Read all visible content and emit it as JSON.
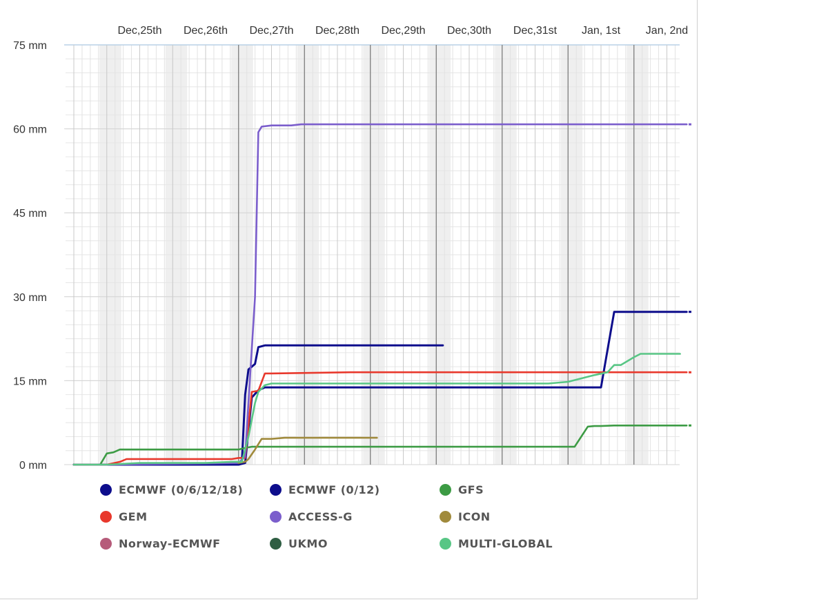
{
  "chart_data": {
    "type": "line",
    "x_tick_labels": [
      "Dec,25th",
      "Dec,26th",
      "Dec,27th",
      "Dec,28th",
      "Dec,29th",
      "Dec,30th",
      "Dec,31st",
      "Jan, 1st",
      "Jan, 2nd"
    ],
    "y_tick_labels": [
      "0 mm",
      "15 mm",
      "30 mm",
      "45 mm",
      "60 mm",
      "75 mm"
    ],
    "x_range": [
      0,
      9.3
    ],
    "ylim": [
      0,
      75
    ],
    "grid": true,
    "legend_position": "bottom",
    "series": [
      {
        "name": "ECMWF (0/6/12/18)",
        "color": "#0d0d8c",
        "x": [
          0,
          0.5,
          2.45,
          2.55,
          2.6,
          2.65,
          2.75,
          2.8,
          2.9,
          3.0,
          5.6
        ],
        "y": [
          0,
          0,
          0,
          0.3,
          12.5,
          17,
          18,
          21,
          21.3,
          21.3,
          21.3
        ]
      },
      {
        "name": "ECMWF (0/12)",
        "color": "#0d0d8c",
        "x": [
          0,
          0.5,
          2.5,
          2.6,
          2.7,
          2.8,
          2.9,
          3.0,
          7.8,
          8.0,
          8.2,
          9.3
        ],
        "y": [
          0,
          0,
          0,
          0.3,
          12,
          13.3,
          13.8,
          13.8,
          13.8,
          13.8,
          27.3,
          27.3
        ]
      },
      {
        "name": "GFS",
        "color": "#3c9b44",
        "x": [
          0,
          0.4,
          0.5,
          0.6,
          0.7,
          1.0,
          1.5,
          2.0,
          2.4,
          2.5,
          2.6,
          2.7,
          2.8,
          3.0,
          7.5,
          7.6,
          7.8,
          7.9,
          8.0,
          8.2,
          9.3
        ],
        "y": [
          0,
          0,
          2.0,
          2.2,
          2.7,
          2.7,
          2.7,
          2.7,
          2.7,
          2.7,
          3.0,
          3.2,
          3.2,
          3.2,
          3.2,
          3.2,
          6.8,
          6.9,
          6.9,
          7.0,
          7.0
        ]
      },
      {
        "name": "GEM",
        "color": "#e8382c",
        "x": [
          0,
          0.5,
          0.7,
          0.8,
          1.0,
          2.4,
          2.5,
          2.6,
          2.7,
          2.8,
          2.9,
          3.0,
          4.2,
          9.3
        ],
        "y": [
          0,
          0,
          0.5,
          1.0,
          1.0,
          1.0,
          1.2,
          1.2,
          13,
          13.2,
          16.3,
          16.3,
          16.5,
          16.5
        ]
      },
      {
        "name": "ACCESS-G",
        "color": "#7b5ecc",
        "x": [
          0,
          0.5,
          2.5,
          2.6,
          2.75,
          2.8,
          2.85,
          3.0,
          3.3,
          3.45,
          9.3
        ],
        "y": [
          0,
          0,
          0.3,
          1.5,
          30,
          59.4,
          60.4,
          60.6,
          60.6,
          60.8,
          60.8
        ]
      },
      {
        "name": "ICON",
        "color": "#a08a3c",
        "x": [
          2.5,
          2.6,
          2.65,
          2.75,
          2.85,
          3.0,
          3.2,
          4.6
        ],
        "y": [
          0.3,
          0.5,
          1.0,
          2.7,
          4.6,
          4.6,
          4.8,
          4.8
        ]
      },
      {
        "name": "Norway-ECMWF",
        "color": "#b65b7a",
        "x": [],
        "y": []
      },
      {
        "name": "UKMO",
        "color": "#2f5e43",
        "x": [],
        "y": []
      },
      {
        "name": "MULTI-GLOBAL",
        "color": "#58c685",
        "x": [
          0,
          0.5,
          1.0,
          2.0,
          2.4,
          2.55,
          2.65,
          2.75,
          2.8,
          2.9,
          3.0,
          3.5,
          7.2,
          7.5,
          7.9,
          8.1,
          8.2,
          8.3,
          8.5,
          8.6,
          8.8,
          9.2
        ],
        "y": [
          0,
          0,
          0.3,
          0.3,
          0.5,
          0.5,
          5.0,
          11.0,
          13.0,
          14.2,
          14.5,
          14.5,
          14.5,
          14.8,
          16.0,
          16.5,
          17.8,
          17.8,
          19.2,
          19.8,
          19.8,
          19.8
        ]
      }
    ]
  }
}
